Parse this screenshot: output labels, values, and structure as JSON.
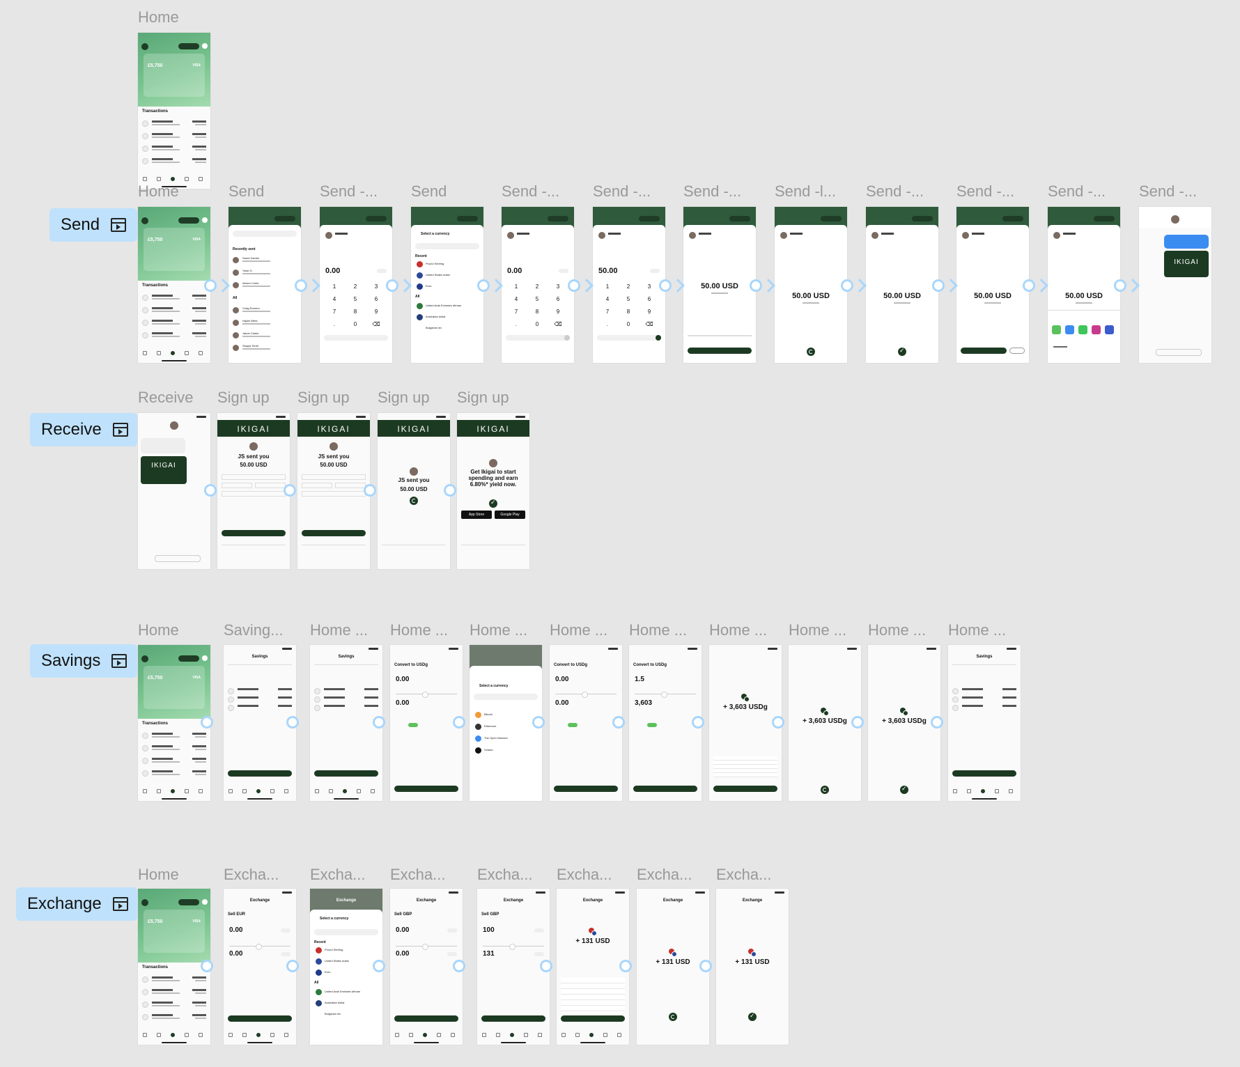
{
  "flows": {
    "send": "Send",
    "receive": "Receive",
    "savings": "Savings",
    "exchange": "Exchange"
  },
  "titles": {
    "home_top": "Home",
    "send": [
      "Home",
      "Send",
      "Send -...",
      "Send",
      "Send -...",
      "Send -...",
      "Send -...",
      "Send -l...",
      "Send -...",
      "Send -...",
      "Send -...",
      "Send -..."
    ],
    "receive": [
      "Receive",
      "Sign up",
      "Sign up",
      "Sign up",
      "Sign up"
    ],
    "savings": [
      "Home",
      "Saving...",
      "Home ...",
      "Home ...",
      "Home ...",
      "Home ...",
      "Home ...",
      "Home ...",
      "Home ...",
      "Home ...",
      "Home ..."
    ],
    "exchange": [
      "Home",
      "Excha...",
      "Excha...",
      "Excha...",
      "Excha...",
      "Excha...",
      "Excha...",
      "Excha..."
    ]
  },
  "screen_text": {
    "balance": "£5,750",
    "visa": "VISA",
    "transactions": "Transactions",
    "recently_sent": "Recently sent",
    "all": "All",
    "select_currency": "Select a currency",
    "recent": "Recent",
    "zero": "0.00",
    "fifty": "50.00",
    "fifty_usd": "50.00 USD",
    "ikigai": "IKIGAI",
    "js_sent": "JS sent you",
    "get_ikigai": "Get Ikigai to start spending and earn 6.80%* yield now.",
    "app_store": "App Store",
    "google_play": "Google Play",
    "savings_title": "Savings",
    "convert_usdg": "Convert to USDg",
    "one_five": "1.5",
    "three_six": "3,603",
    "plus_usdg": "+ 3,603 USDg",
    "exchange_title": "Exchange",
    "sell_eur": "Sell EUR",
    "sell_gbp": "Sell GBP",
    "hundred": "100",
    "one_three_one": "131",
    "plus_usd": "+ 131 USD",
    "keypad": [
      "1",
      "2",
      "3",
      "4",
      "5",
      "6",
      "7",
      "8",
      "9",
      ".",
      "0",
      "⌫"
    ],
    "currencies": [
      "Pound Sterling",
      "United States dollar",
      "Euro",
      "United Arab Emirates dirham",
      "Australian dollar",
      "Bulgarian lev"
    ],
    "cryptos": [
      "Bitcoin",
      "Ethereum",
      "The Open Network",
      "Solana"
    ],
    "contacts": [
      "Sarah Davies",
      "Yasin S.",
      "Abram Curtis",
      "Craig Romero",
      "Haylin Miles",
      "Jakob Clarke",
      "Shayla Terrel"
    ]
  },
  "colors": {
    "canvas": "#e6e6e6",
    "label_bg": "#bfe1fb",
    "connector": "#a9d6fb",
    "brand_dark": "#1c3a22",
    "brand_green": "#79c48f"
  }
}
